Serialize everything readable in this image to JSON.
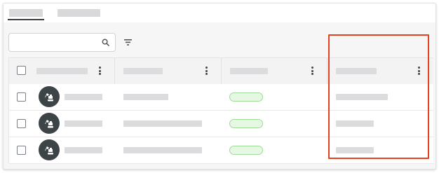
{
  "tabs": [
    {
      "label": "",
      "active": true
    },
    {
      "label": "",
      "active": false
    }
  ],
  "search": {
    "placeholder": "",
    "value": "",
    "icon": "search-icon"
  },
  "filter": {
    "icon": "filter-icon"
  },
  "table": {
    "columns": [
      {
        "label": "",
        "has_menu": true
      },
      {
        "label": "",
        "has_menu": true
      },
      {
        "label": "",
        "has_menu": true
      },
      {
        "label": "",
        "has_menu": true
      }
    ],
    "rows": [
      {
        "icon": "excavator-icon",
        "name": "",
        "col2": "",
        "status": "",
        "col4": ""
      },
      {
        "icon": "excavator-icon",
        "name": "",
        "col2": "",
        "status": "",
        "col4": ""
      },
      {
        "icon": "excavator-icon",
        "name": "",
        "col2": "",
        "status": "",
        "col4": ""
      }
    ]
  },
  "colors": {
    "highlight": "#e7401f",
    "status_pill_bg": "#e6f7e3",
    "status_pill_border": "#9fdc97",
    "avatar_bg": "#3d4448"
  }
}
